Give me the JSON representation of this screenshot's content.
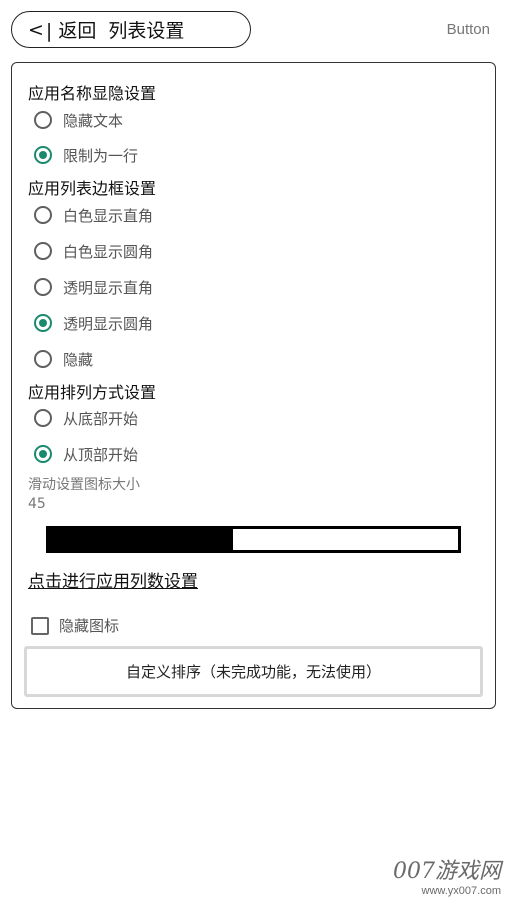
{
  "header": {
    "back_arrow": "<",
    "back_label": "| 返回",
    "title": "列表设置",
    "right_button": "Button"
  },
  "sections": {
    "name_display": {
      "title": "应用名称显隐设置",
      "options": [
        {
          "label": "隐藏文本",
          "checked": false
        },
        {
          "label": "限制为一行",
          "checked": true
        }
      ]
    },
    "border": {
      "title": "应用列表边框设置",
      "options": [
        {
          "label": "白色显示直角",
          "checked": false
        },
        {
          "label": "白色显示圆角",
          "checked": false
        },
        {
          "label": "透明显示直角",
          "checked": false
        },
        {
          "label": "透明显示圆角",
          "checked": true
        },
        {
          "label": "隐藏",
          "checked": false
        }
      ]
    },
    "order": {
      "title": "应用排列方式设置",
      "options": [
        {
          "label": "从底部开始",
          "checked": false
        },
        {
          "label": "从顶部开始",
          "checked": true
        }
      ]
    }
  },
  "icon_size": {
    "label": "滑动设置图标大小",
    "value": "45",
    "progress_fraction": 0.45
  },
  "columns_link": "点击进行应用列数设置",
  "hide_icon": {
    "label": "隐藏图标",
    "checked": false
  },
  "custom_sort_button": "自定义排序（未完成功能，无法使用）",
  "watermark": {
    "brand": "007游戏网",
    "url": "www.yx007.com"
  },
  "colors": {
    "accent": "#1a8a6e",
    "progress": "#000000"
  }
}
